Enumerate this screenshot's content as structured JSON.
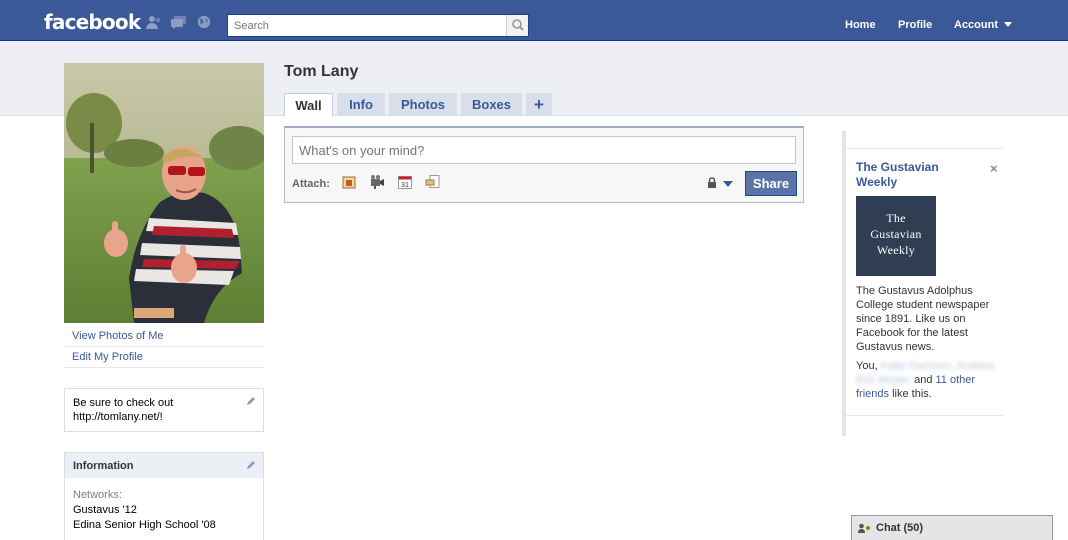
{
  "topbar": {
    "logo": "facebook",
    "search": {
      "placeholder": "Search"
    },
    "nav": {
      "home": "Home",
      "profile": "Profile",
      "account": "Account"
    }
  },
  "profile": {
    "name": "Tom Lany",
    "links": {
      "view_photos": "View Photos of Me",
      "edit_profile": "Edit My Profile"
    },
    "bio": "Be sure to check out http://tomlany.net/!",
    "information": {
      "title": "Information",
      "networks_label": "Networks:",
      "networks": [
        "Gustavus '12",
        "Edina Senior High School '08"
      ]
    }
  },
  "tabs": [
    {
      "label": "Wall",
      "active": true
    },
    {
      "label": "Info"
    },
    {
      "label": "Photos"
    },
    {
      "label": "Boxes"
    },
    {
      "label": "+"
    }
  ],
  "publisher": {
    "placeholder": "What's on your mind?",
    "attach_label": "Attach:",
    "attach_icons": [
      "photo-icon",
      "video-icon",
      "event-icon",
      "link-icon"
    ],
    "calendar_day": "31",
    "share_label": "Share"
  },
  "ad": {
    "title": "The Gustavian Weekly",
    "close": "×",
    "logo_lines": [
      "The",
      "Gustavian",
      "Weekly"
    ],
    "body": "The Gustavus Adolphus College student newspaper since 1891. Like us on Facebook for the latest Gustavus news.",
    "social": {
      "prefix": "You,",
      "friend1": "Katie Garrison,",
      "friend2": "Andrew Eric Moyer,",
      "and": "and",
      "others": "11 other friends",
      "suffix": "like this."
    }
  },
  "chat": {
    "label": "Chat (50)"
  },
  "colors": {
    "brand": "#3b5998",
    "band": "#edeff4",
    "share": "#5b74a8"
  }
}
